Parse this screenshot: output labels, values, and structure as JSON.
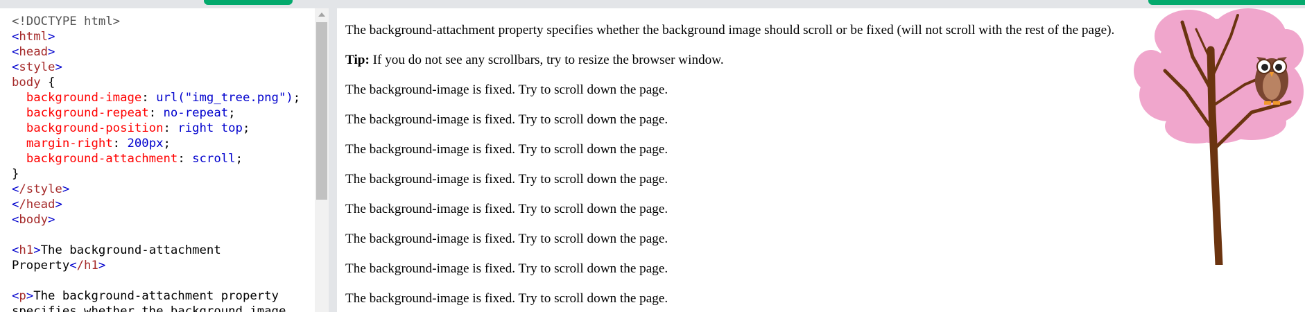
{
  "editor": {
    "lines": {
      "l1": "<!DOCTYPE html>",
      "l2_tag": "html",
      "l3_tag": "head",
      "l4_tag": "style",
      "l5_selector": "body",
      "l5_brace": "{",
      "l6_prop": "background-image",
      "l6_val": "url(\"img_tree.png\")",
      "l7_prop": "background-repeat",
      "l7_val": "no-repeat",
      "l8_prop": "background-position",
      "l8_val": "right top",
      "l9_prop": "margin-right",
      "l9_val": "200px",
      "l10_prop": "background-attachment",
      "l10_val": "scroll",
      "l11_brace": "}",
      "l12_tag": "/style",
      "l13_tag": "/head",
      "l14_tag": "body",
      "l16_open": "h1",
      "l16_text": "The background-attachment",
      "l17_text": "Property",
      "l17_close": "/h1",
      "l19_open": "p",
      "l19_text": "The background-attachment property",
      "l20_text": "specifies whether the background image"
    }
  },
  "result": {
    "intro": "The background-attachment property specifies whether the background image should scroll or be fixed (will not scroll with the rest of the page).",
    "tip_label": "Tip:",
    "tip_text": " If you do not see any scrollbars, try to resize the browser window.",
    "fixed_lines": [
      "The background-image is fixed. Try to scroll down the page.",
      "The background-image is fixed. Try to scroll down the page.",
      "The background-image is fixed. Try to scroll down the page.",
      "The background-image is fixed. Try to scroll down the page.",
      "The background-image is fixed. Try to scroll down the page.",
      "The background-image is fixed. Try to scroll down the page.",
      "The background-image is fixed. Try to scroll down the page.",
      "The background-image is fixed. Try to scroll down the page."
    ]
  },
  "colors": {
    "accent_green": "#04aa6d",
    "tree_pink": "#f0a6cc",
    "trunk_brown": "#6b3410",
    "owl_brown": "#7a4630"
  },
  "icons": {
    "tree": "tree-with-owl-image",
    "scroll_up": "scroll-up-arrow"
  }
}
